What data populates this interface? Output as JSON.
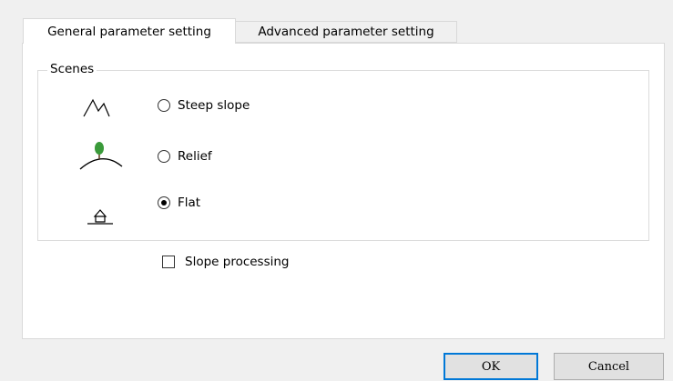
{
  "tabs": [
    {
      "label": "General parameter setting",
      "active": true
    },
    {
      "label": "Advanced parameter setting",
      "active": false
    }
  ],
  "scenes": {
    "title": "Scenes",
    "options": [
      {
        "label": "Steep slope",
        "icon": "steep-slope-icon",
        "selected": false
      },
      {
        "label": "Relief",
        "icon": "relief-icon",
        "selected": false
      },
      {
        "label": "Flat",
        "icon": "flat-icon",
        "selected": true
      }
    ]
  },
  "slope_processing": {
    "label": "Slope processing",
    "checked": false
  },
  "buttons": {
    "ok": "OK",
    "cancel": "Cancel"
  },
  "colors": {
    "accent": "#0078d7",
    "tree": "#3a9a3a"
  }
}
